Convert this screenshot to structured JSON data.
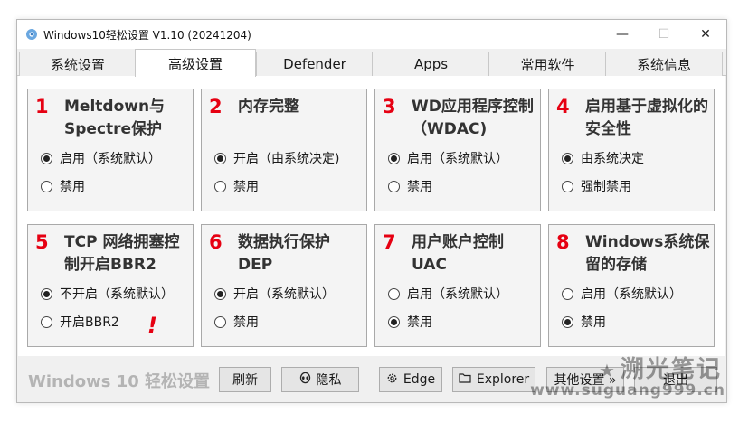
{
  "window": {
    "title": "Windows10轻松设置 V1.10 (20241204)",
    "controls": {
      "minimize": "—",
      "maximize": "☐",
      "close": "✕"
    }
  },
  "tabs": [
    {
      "label": "系统设置"
    },
    {
      "label": "高级设置",
      "active": true
    },
    {
      "label": "Defender"
    },
    {
      "label": "Apps"
    },
    {
      "label": "常用软件"
    },
    {
      "label": "系统信息"
    }
  ],
  "cards": [
    {
      "num": "1",
      "title": "Meltdown与Spectre保护",
      "options": [
        "启用（系统默认）",
        "禁用"
      ],
      "selected": 0
    },
    {
      "num": "2",
      "title": "内存完整",
      "options": [
        "开启（由系统决定)",
        "禁用"
      ],
      "selected": 0
    },
    {
      "num": "3",
      "title": "WD应用程序控制（WDAC)",
      "options": [
        "启用（系统默认）",
        "禁用"
      ],
      "selected": 0
    },
    {
      "num": "4",
      "title": "启用基于虚拟化的安全性",
      "options": [
        "由系统决定",
        "强制禁用"
      ],
      "selected": 0
    },
    {
      "num": "5",
      "title": "TCP 网络拥塞控制开启BBR2",
      "options": [
        "不开启（系统默认）",
        "开启BBR2"
      ],
      "selected": 0,
      "warning": "!"
    },
    {
      "num": "6",
      "title": "数据执行保护DEP",
      "options": [
        "开启（系统默认）",
        "禁用"
      ],
      "selected": 0
    },
    {
      "num": "7",
      "title": "用户账户控制UAC",
      "options": [
        "启用（系统默认）",
        "禁用"
      ],
      "selected": 1
    },
    {
      "num": "8",
      "title": "Windows系统保留的存储",
      "options": [
        "启用（系统默认）",
        "禁用"
      ],
      "selected": 1
    }
  ],
  "footer": {
    "brand": "Windows 10 轻松设置",
    "buttons": {
      "refresh": "刷新",
      "privacy": "隐私",
      "edge": "Edge",
      "explorer": "Explorer",
      "other": "其他设置 »",
      "exit": "退出"
    },
    "icons": {
      "privacy": "alien-icon",
      "edge": "gear-icon",
      "explorer": "folder-icon"
    }
  },
  "watermark": {
    "line1": "溯光笔记",
    "line2": "www.suguang999.cn"
  },
  "colors": {
    "accent_number": "#e60012",
    "window_bg": "#f0f0f0",
    "card_bg": "#f4f4f4"
  }
}
